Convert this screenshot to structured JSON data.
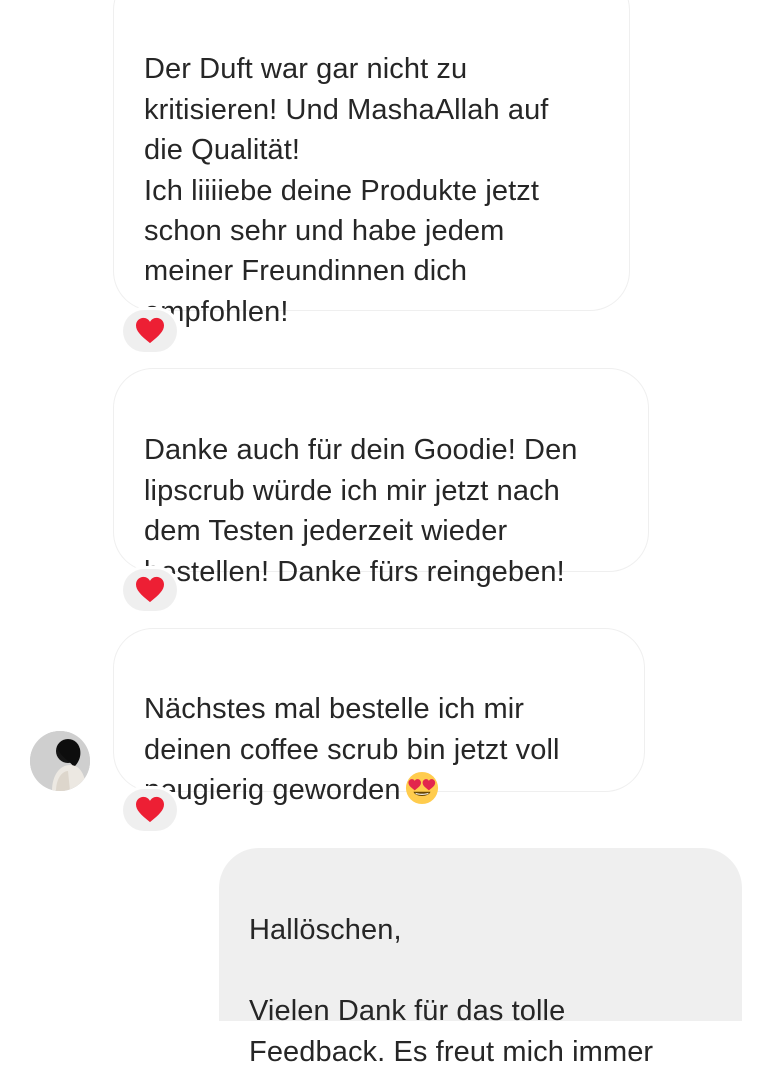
{
  "messages": [
    {
      "direction": "incoming",
      "text": "Der Duft war gar nicht zu\nkritisieren! Und MashaAllah auf\ndie Qualität!\nIch liiiiebe deine Produkte jetzt\nschon sehr und habe jedem\nmeiner Freundinnen dich\nempfohlen!",
      "reaction": "red-heart"
    },
    {
      "direction": "incoming",
      "text": "Danke auch für dein Goodie! Den\nlipscrub würde ich mir jetzt nach\ndem Testen jederzeit wieder\nbestellen! Danke fürs reingeben!",
      "reaction": "red-heart"
    },
    {
      "direction": "incoming",
      "text": "Nächstes mal bestelle ich mir\ndeinen coffee scrub bin jetzt voll\nneugierig geworden",
      "trailing_emoji": "heart-eyes-emoji",
      "reaction": "red-heart"
    },
    {
      "direction": "outgoing",
      "text": "Hallöschen,\n\nVielen Dank für das tolle\nFeedback. Es freut mich immer"
    }
  ],
  "sender_avatar": "profile-avatar",
  "colors": {
    "incoming_bubble_bg": "#ffffff",
    "incoming_bubble_border": "#efefef",
    "outgoing_bubble_bg": "#efefef",
    "text": "#262626",
    "heart": "#ed1f34"
  }
}
